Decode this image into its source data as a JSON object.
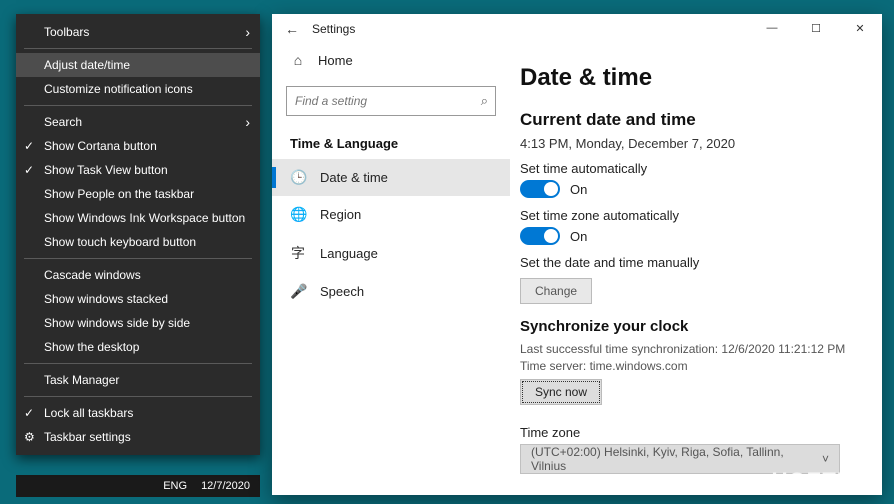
{
  "ctx": {
    "toolbars": "Toolbars",
    "adjust": "Adjust date/time",
    "customize": "Customize notification icons",
    "search": "Search",
    "cortana": "Show Cortana button",
    "taskview": "Show Task View button",
    "people": "Show People on the taskbar",
    "ink": "Show Windows Ink Workspace button",
    "touch": "Show touch keyboard button",
    "cascade": "Cascade windows",
    "stacked": "Show windows stacked",
    "sidebyside": "Show windows side by side",
    "desktop": "Show the desktop",
    "taskmgr": "Task Manager",
    "lock": "Lock all taskbars",
    "settings": "Taskbar settings"
  },
  "taskbar": {
    "lang": "ENG",
    "date": "12/7/2020"
  },
  "win": {
    "back": "←",
    "title": "Settings",
    "min": "—",
    "max": "☐",
    "close": "✕"
  },
  "nav": {
    "home": "Home",
    "placeholder": "Find a setting",
    "group": "Time & Language",
    "items": [
      {
        "icon": "🕒",
        "label": "Date & time"
      },
      {
        "icon": "🌐",
        "label": "Region"
      },
      {
        "icon": "字",
        "label": "Language"
      },
      {
        "icon": "🎤",
        "label": "Speech"
      }
    ]
  },
  "pane": {
    "title": "Date & time",
    "current_hdr": "Current date and time",
    "current_val": "4:13 PM, Monday, December 7, 2020",
    "auto_time_lbl": "Set time automatically",
    "auto_tz_lbl": "Set time zone automatically",
    "on": "On",
    "manual_lbl": "Set the date and time manually",
    "change": "Change",
    "sync_hdr": "Synchronize your clock",
    "sync_last": "Last successful time synchronization: 12/6/2020 11:21:12 PM",
    "sync_server": "Time server: time.windows.com",
    "sync_btn": "Sync now",
    "tz_lbl": "Time zone",
    "tz_val": "(UTC+02:00) Helsinki, Kyiv, Riga, Sofia, Tallinn, Vilnius"
  },
  "watermark": "UGETFIX"
}
